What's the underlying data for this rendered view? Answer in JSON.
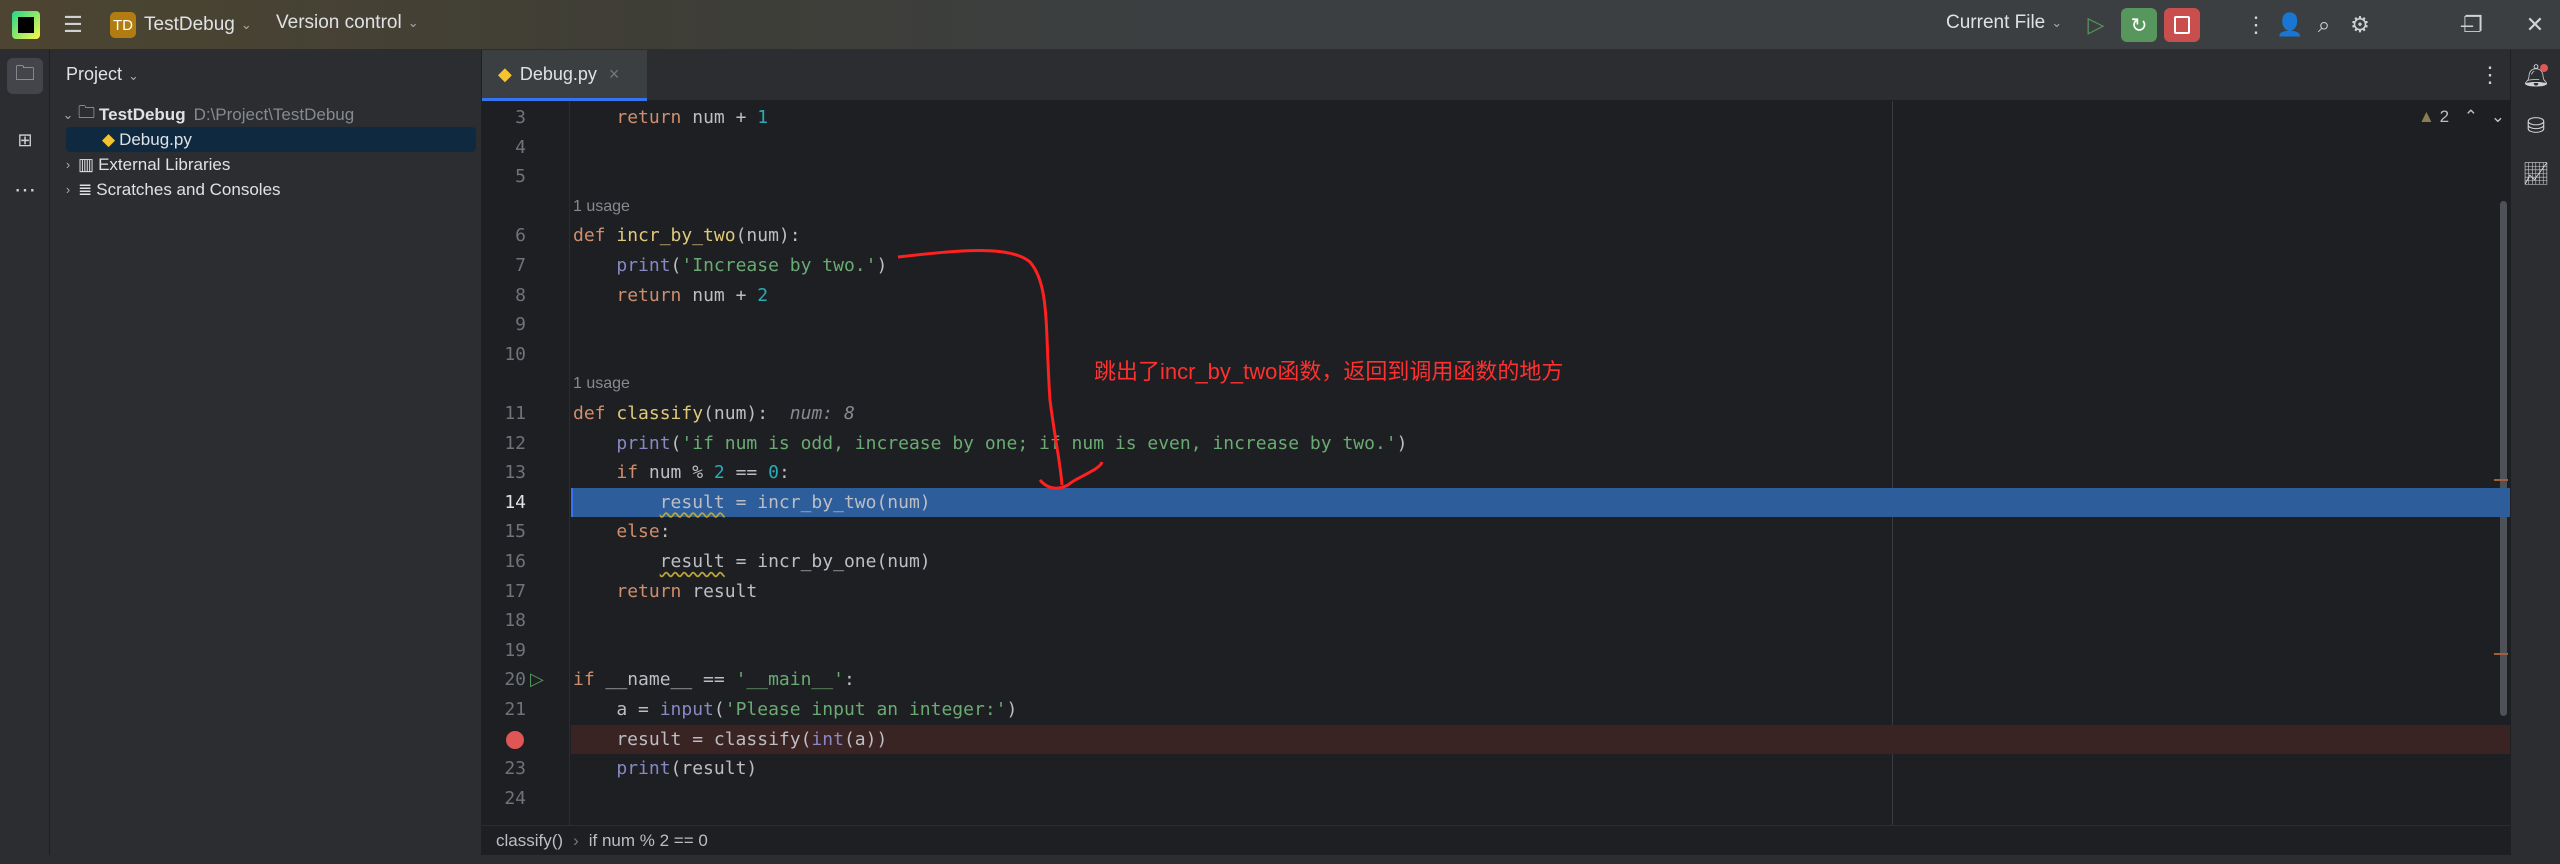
{
  "titlebar": {
    "project_initials": "TD",
    "project_name": "TestDebug",
    "vcs": "Version control",
    "run_config": "Current File"
  },
  "project_panel": {
    "title": "Project",
    "root": {
      "name": "TestDebug",
      "path": "D:\\Project\\TestDebug"
    },
    "file": "Debug.py",
    "items": [
      "External Libraries",
      "Scratches and Consoles"
    ]
  },
  "tab": {
    "label": "Debug.py",
    "close": "×"
  },
  "inspections": {
    "warnings": "2"
  },
  "usage_label": "1 usage",
  "inline_hint": "num: 8",
  "line_numbers": [
    "3",
    "4",
    "5",
    "6",
    "7",
    "8",
    "9",
    "10",
    "11",
    "12",
    "13",
    "14",
    "15",
    "16",
    "17",
    "18",
    "19",
    "20",
    "21",
    "23",
    "24"
  ],
  "annotation": "跳出了incr_by_two函数，返回到调用函数的地方",
  "breadcrumb": {
    "func": "classify()",
    "stmt": "if num % 2 == 0"
  },
  "colors": {
    "highlight": "#2d5d9b",
    "breakpoint": "#e05555",
    "annotation": "#ff3030"
  }
}
